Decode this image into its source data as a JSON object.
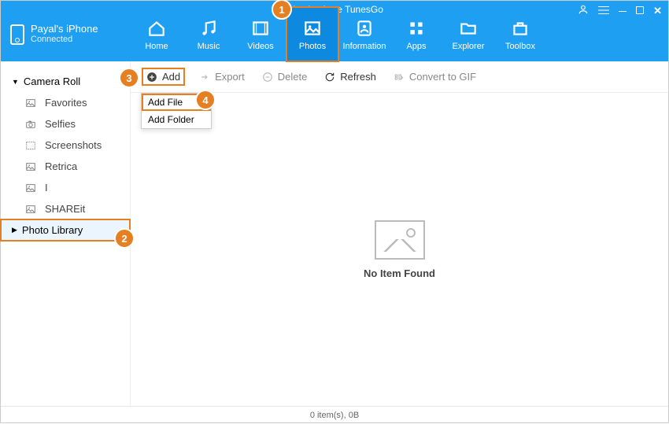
{
  "app": {
    "title": "Wondershare TunesGo"
  },
  "device": {
    "name": "Payal's iPhone",
    "status": "Connected"
  },
  "nav": [
    {
      "label": "Home",
      "icon": "home"
    },
    {
      "label": "Music",
      "icon": "music"
    },
    {
      "label": "Videos",
      "icon": "videos"
    },
    {
      "label": "Photos",
      "icon": "photos",
      "selected": true
    },
    {
      "label": "Information",
      "icon": "information"
    },
    {
      "label": "Apps",
      "icon": "apps"
    },
    {
      "label": "Explorer",
      "icon": "explorer"
    },
    {
      "label": "Toolbox",
      "icon": "toolbox"
    }
  ],
  "sidebar": {
    "groups": [
      {
        "label": "Camera Roll",
        "expanded": true,
        "children": [
          {
            "label": "Favorites",
            "icon": "photo"
          },
          {
            "label": "Selfies",
            "icon": "camera"
          },
          {
            "label": "Screenshots",
            "icon": "screenshot"
          },
          {
            "label": "Retrica",
            "icon": "photo"
          },
          {
            "label": "I",
            "icon": "photo"
          },
          {
            "label": "SHAREit",
            "icon": "photo"
          }
        ]
      },
      {
        "label": "Photo Library",
        "expanded": false,
        "selected": true
      }
    ]
  },
  "toolbar": {
    "add": "Add",
    "export": "Export",
    "delete": "Delete",
    "refresh": "Refresh",
    "gif": "Convert to GIF",
    "dropdown": [
      {
        "label": "Add File",
        "highlight": true
      },
      {
        "label": "Add Folder"
      }
    ]
  },
  "empty": {
    "label": "No Item Found"
  },
  "status": {
    "text": "0 item(s), 0B"
  },
  "badges": {
    "1": "1",
    "2": "2",
    "3": "3",
    "4": "4"
  }
}
